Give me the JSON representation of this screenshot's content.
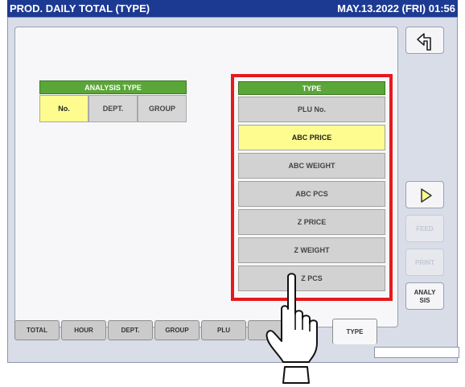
{
  "header": {
    "title": "PROD. DAILY TOTAL (TYPE)",
    "datetime": "MAY.13.2022 (FRI) 01:56"
  },
  "analysis": {
    "heading": "ANALYSIS TYPE",
    "options": [
      "No.",
      "DEPT.",
      "GROUP"
    ],
    "selected": "No."
  },
  "type": {
    "heading": "TYPE",
    "options": [
      "PLU No.",
      "ABC PRICE",
      "ABC WEIGHT",
      "ABC PCS",
      "Z PRICE",
      "Z WEIGHT",
      "Z PCS"
    ],
    "selected": "ABC PRICE"
  },
  "side": {
    "back_icon": "return-arrow-icon",
    "next_icon": "play-right-icon",
    "feed": "FEED",
    "print": "PRINT",
    "analysis": "ANALY SIS",
    "analysis_line1": "ANALY",
    "analysis_line2": "SIS"
  },
  "tabs": [
    "TOTAL",
    "HOUR",
    "DEPT.",
    "GROUP",
    "PLU",
    "",
    "TYPE"
  ],
  "active_tab": "TYPE",
  "colors": {
    "titlebar": "#1d3a93",
    "header_green": "#5aa638",
    "selected_yellow": "#fefc8e",
    "highlight_red": "#e5191e"
  }
}
